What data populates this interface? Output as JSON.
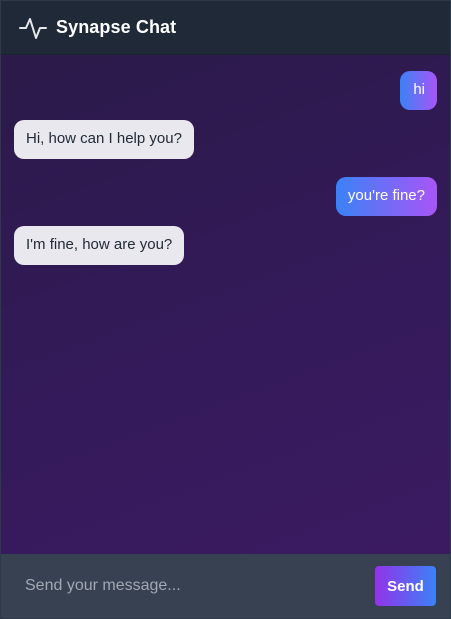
{
  "header": {
    "title": "Synapse Chat",
    "logo_icon": "activity-pulse-icon"
  },
  "messages": [
    {
      "sender": "user",
      "text": "hi"
    },
    {
      "sender": "bot",
      "text": "Hi, how can I help you?"
    },
    {
      "sender": "user",
      "text": "you're fine?"
    },
    {
      "sender": "bot",
      "text": "I'm fine, how are you?"
    }
  ],
  "composer": {
    "placeholder": "Send your message...",
    "value": "",
    "send_label": "Send"
  },
  "colors": {
    "header_bg": "#1f2937",
    "footer_bg": "#374151",
    "user_bubble_from": "#3b82f6",
    "user_bubble_to": "#a855f7",
    "bot_bubble": "#e8e8ee",
    "send_from": "#9333ea",
    "send_to": "#3b82f6"
  }
}
